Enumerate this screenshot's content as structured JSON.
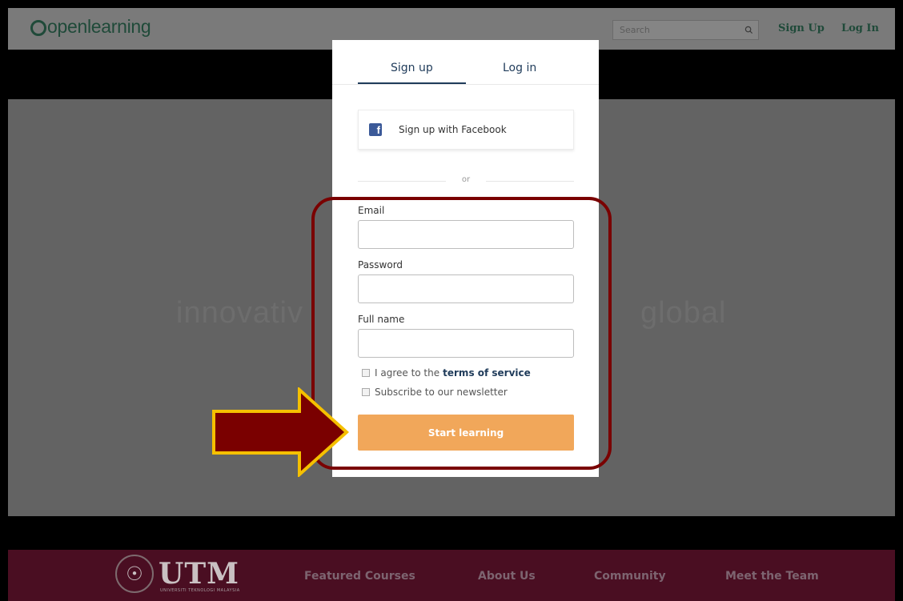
{
  "header": {
    "logo_text": "openlearning",
    "search_placeholder": "Search",
    "signup_link": "Sign Up",
    "login_link": "Log In"
  },
  "hero": {
    "tagline_fragment_left": "innovativ",
    "tagline_fragment_right": "global"
  },
  "modal": {
    "tabs": [
      {
        "label": "Sign up",
        "active": true
      },
      {
        "label": "Log in",
        "active": false
      }
    ],
    "facebook_button": "Sign up with Facebook",
    "or_text": "or",
    "fields": {
      "email_label": "Email",
      "email_value": "",
      "password_label": "Password",
      "password_value": "",
      "fullname_label": "Full name",
      "fullname_value": ""
    },
    "terms_prefix": "I agree to the",
    "terms_link": "terms of service",
    "newsletter_label": "Subscribe to our newsletter",
    "submit_button": "Start learning"
  },
  "footer": {
    "brand": "UTM",
    "brand_subtitle": "UNIVERSITI TEKNOLOGI MALAYSIA",
    "links": [
      "Featured Courses",
      "About Us",
      "Community",
      "Meet the Team"
    ]
  },
  "colors": {
    "brand_green": "#1f4a39",
    "footer_bg": "#4a0e22",
    "submit_orange": "#f1a75a",
    "facebook_blue": "#3b5998",
    "annotation_red": "#7a0000",
    "annotation_gold": "#f5c000"
  }
}
